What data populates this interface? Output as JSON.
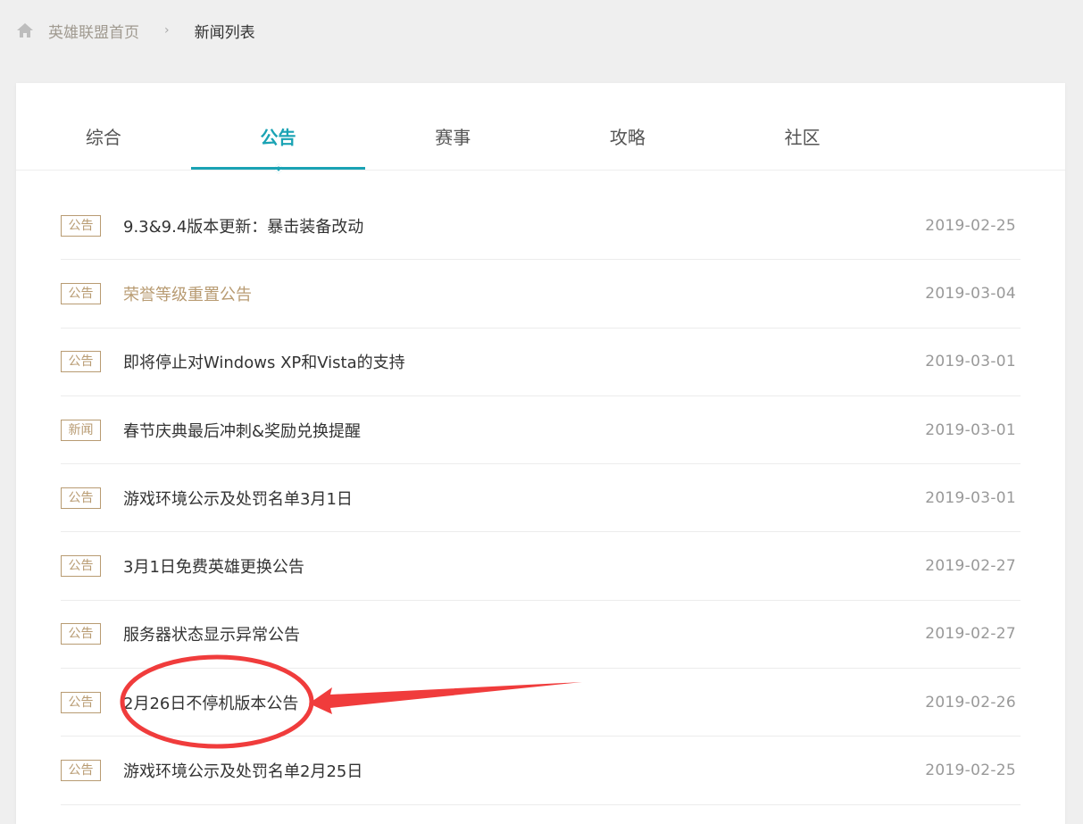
{
  "breadcrumb": {
    "home_label": "英雄联盟首页",
    "separator": "›",
    "current": "新闻列表"
  },
  "tabs": [
    {
      "label": "综合",
      "active": false
    },
    {
      "label": "公告",
      "active": true
    },
    {
      "label": "赛事",
      "active": false
    },
    {
      "label": "攻略",
      "active": false
    },
    {
      "label": "社区",
      "active": false
    }
  ],
  "news": [
    {
      "tag": "公告",
      "title": "9.3&9.4版本更新：暴击装备改动",
      "date": "2019-02-25",
      "highlight": false
    },
    {
      "tag": "公告",
      "title": "荣誉等级重置公告",
      "date": "2019-03-04",
      "highlight": true
    },
    {
      "tag": "公告",
      "title": "即将停止对Windows XP和Vista的支持",
      "date": "2019-03-01",
      "highlight": false
    },
    {
      "tag": "新闻",
      "title": "春节庆典最后冲刺&奖励兑换提醒",
      "date": "2019-03-01",
      "highlight": false
    },
    {
      "tag": "公告",
      "title": "游戏环境公示及处罚名单3月1日",
      "date": "2019-03-01",
      "highlight": false
    },
    {
      "tag": "公告",
      "title": "3月1日免费英雄更换公告",
      "date": "2019-02-27",
      "highlight": false
    },
    {
      "tag": "公告",
      "title": "服务器状态显示异常公告",
      "date": "2019-02-27",
      "highlight": false
    },
    {
      "tag": "公告",
      "title": "2月26日不停机版本公告",
      "date": "2019-02-26",
      "highlight": false
    },
    {
      "tag": "公告",
      "title": "游戏环境公示及处罚名单2月25日",
      "date": "2019-02-25",
      "highlight": false
    }
  ],
  "colors": {
    "accent": "#1aa3b4",
    "tag": "#b89b72",
    "annotation": "#f03c3c"
  }
}
